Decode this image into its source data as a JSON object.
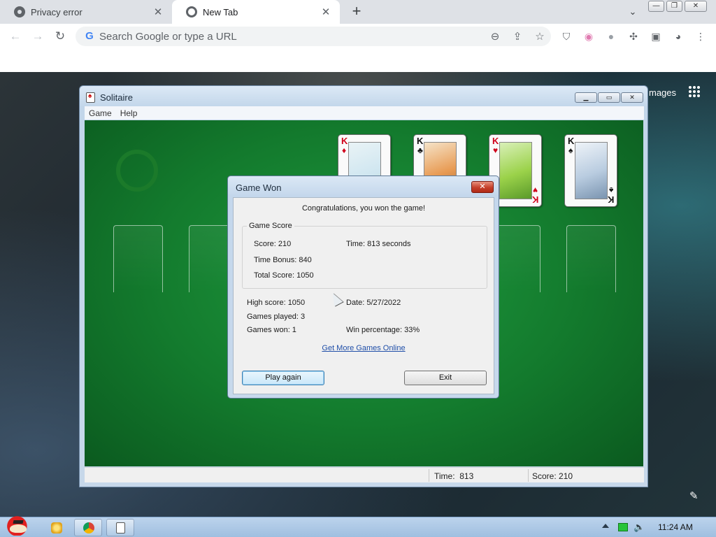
{
  "browser": {
    "tabs": [
      {
        "label": "Privacy error",
        "active": false
      },
      {
        "label": "New Tab",
        "active": true
      }
    ],
    "new_tab_symbol": "+",
    "tab_close_symbol": "✕",
    "omnibox_placeholder": "Search Google or type a URL",
    "google_g": "G",
    "images_link": "mages"
  },
  "solitaire": {
    "title": "Solitaire",
    "menu": [
      "Game",
      "Help"
    ],
    "status": {
      "time_label": "Time:",
      "time_value": "813",
      "score_label": "Score:",
      "score_value": "210"
    },
    "foundation_cards": [
      {
        "rank": "K",
        "suit": "♦",
        "color": "red",
        "art_color": "#cfe6f0"
      },
      {
        "rank": "K",
        "suit": "♣",
        "color": "black",
        "art_color": "#e89a52"
      },
      {
        "rank": "K",
        "suit": "♥",
        "color": "red",
        "art_color": "#9bd24a"
      },
      {
        "rank": "K",
        "suit": "♠",
        "color": "black",
        "art_color": "#b9cce0"
      }
    ]
  },
  "dialog": {
    "title": "Game Won",
    "message": "Congratulations, you won the game!",
    "group_label": "Game Score",
    "score": "Score: 210",
    "time": "Time:  813 seconds",
    "time_bonus": "Time Bonus: 840",
    "total_score": "Total Score: 1050",
    "high_score": "High score: 1050",
    "date": "Date: 5/27/2022",
    "games_played": "Games played: 3",
    "games_won": "Games won: 1",
    "win_percentage": "Win percentage: 33%",
    "link": "Get More Games Online",
    "play_again": "Play again",
    "exit": "Exit"
  },
  "taskbar": {
    "clock": "11:24 AM"
  },
  "colors": {
    "felt": "#137a2d",
    "accent_link": "#1f4ea8",
    "taskbar": "#bcd3ec"
  }
}
